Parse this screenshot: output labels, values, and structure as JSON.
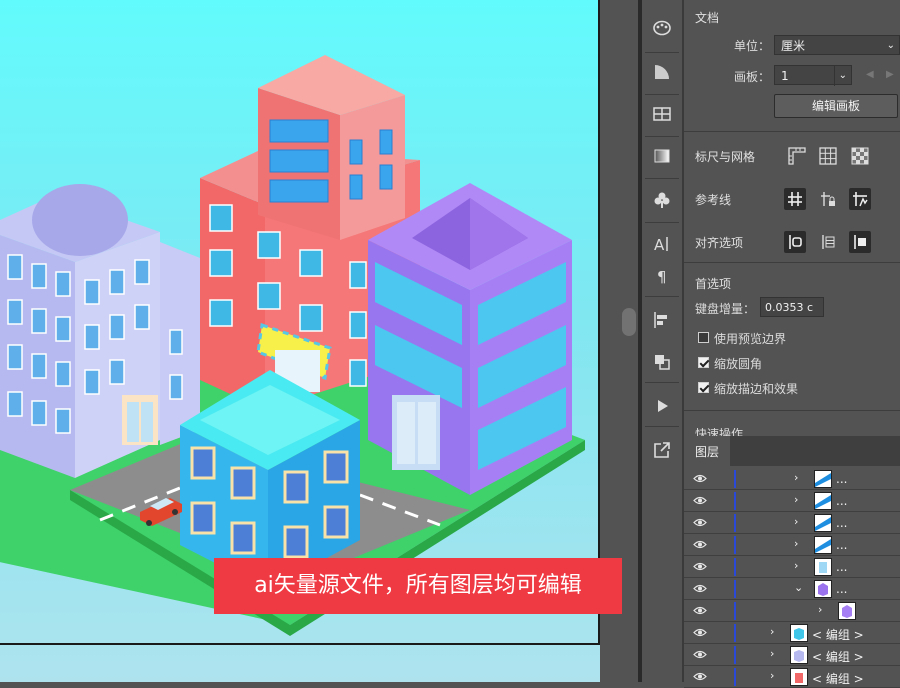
{
  "document": {
    "section_title": "文档",
    "units_label": "单位：",
    "units_value": "厘米",
    "artboard_label": "画板：",
    "artboard_value": "1",
    "edit_artboard_button": "编辑画板"
  },
  "rulers_grids": {
    "title": "标尺与网格",
    "icons": [
      "ruler-icon",
      "grid-icon",
      "transparency-grid-icon"
    ]
  },
  "guides": {
    "title": "参考线",
    "icons": [
      "guides-icon",
      "lock-guides-icon",
      "smart-guides-icon"
    ]
  },
  "align_options": {
    "title": "对齐选项",
    "icons": [
      "align-to-key-icon",
      "align-to-pixel-icon",
      "align-to-artboard-icon"
    ]
  },
  "preferences": {
    "title": "首选项",
    "keyboard_increment_label": "键盘增量：",
    "keyboard_increment_value": "0.0353 c",
    "checkboxes": [
      {
        "label": "使用预览边界",
        "checked": false
      },
      {
        "label": "缩放圆角",
        "checked": true
      },
      {
        "label": "缩放描边和效果",
        "checked": true
      }
    ]
  },
  "quick_actions_partial": "快速操作",
  "layers_panel": {
    "tab": "图层",
    "rows": [
      {
        "indent": 0,
        "twist": "›",
        "name": "...",
        "thumb": "stripe-blue"
      },
      {
        "indent": 0,
        "twist": "›",
        "name": "...",
        "thumb": "stripe-blue"
      },
      {
        "indent": 0,
        "twist": "›",
        "name": "...",
        "thumb": "stripe-blue"
      },
      {
        "indent": 0,
        "twist": "›",
        "name": "...",
        "thumb": "stripe-blue"
      },
      {
        "indent": 0,
        "twist": "›",
        "name": "...",
        "thumb": "light-blue"
      },
      {
        "indent": 0,
        "twist": "⌄",
        "name": "...",
        "thumb": "purple"
      },
      {
        "indent": 1,
        "twist": "›",
        "name": "",
        "thumb": "purple-sub"
      },
      {
        "indent": -1,
        "twist": "›",
        "name": "< 编组 >",
        "thumb": "teal-building"
      },
      {
        "indent": -1,
        "twist": "›",
        "name": "< 编组 >",
        "thumb": "lavender-building"
      },
      {
        "indent": -1,
        "twist": "›",
        "name": "< 编组 >",
        "thumb": "red-building"
      }
    ]
  },
  "banner_text": "ai矢量源文件，所有图层均可编辑",
  "colors": {
    "sky_top": "#62fbfd",
    "sky_bottom": "#aee3ee",
    "banner": "#f03a43",
    "panel": "#535353",
    "layer_color_bar": "#2b49d8"
  }
}
